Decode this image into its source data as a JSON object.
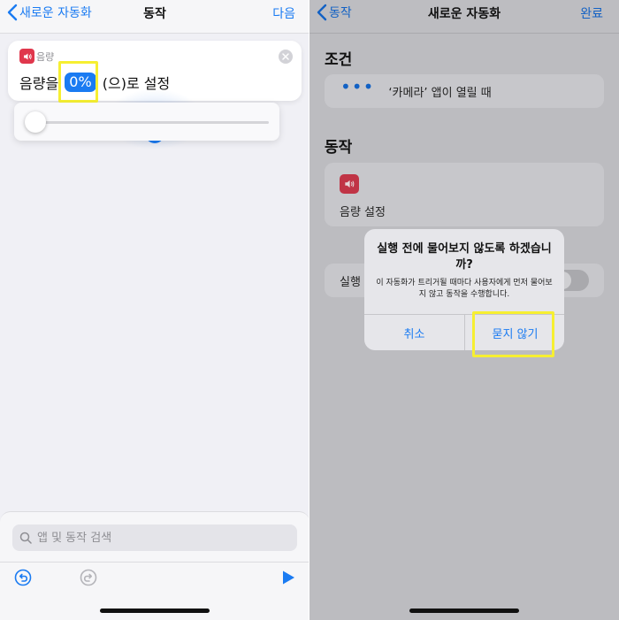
{
  "left": {
    "nav": {
      "back_label": "새로운 자동화",
      "title": "동작",
      "action": "다음"
    },
    "action_card": {
      "app_label": "음량",
      "text_before": "음량을",
      "value": "0%",
      "text_after": "(으)로 설정"
    },
    "slider": {
      "value_percent": 0
    },
    "search": {
      "placeholder": "앱 및 동작 검색"
    },
    "toolbar": {
      "undo_icon": "undo-icon",
      "redo_icon": "redo-icon",
      "run_icon": "play-icon"
    }
  },
  "right": {
    "nav": {
      "back_label": "동작",
      "title": "새로운 자동화",
      "action": "완료"
    },
    "condition": {
      "heading": "조건",
      "item": "‘카메라’ 앱이 열릴 때"
    },
    "action": {
      "heading": "동작",
      "item": "음량 설정"
    },
    "run_row": {
      "label": "실행"
    },
    "alert": {
      "title": "실행 전에 물어보지 않도록 하겠습니까?",
      "message": "이 자동화가 트리거될 때마다 사용자에게 먼저 물어보지 않고 동작을 수행합니다.",
      "cancel": "취소",
      "confirm": "묻지 않기"
    }
  },
  "colors": {
    "accent": "#1a7bf2",
    "volume_icon": "#e0374c",
    "highlight": "#f6ef32"
  }
}
